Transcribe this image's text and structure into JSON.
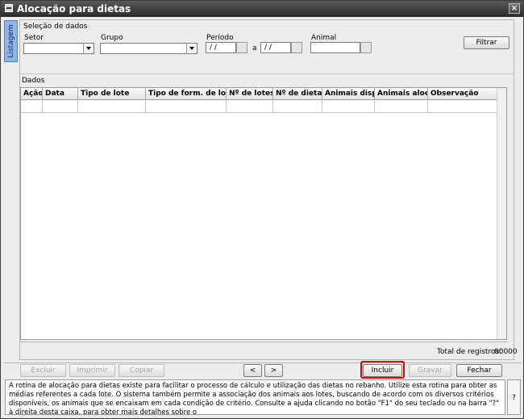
{
  "window": {
    "title": "Alocação para dietas",
    "close_glyph": "×"
  },
  "side_tab": {
    "label": "Listagem"
  },
  "selection": {
    "section_label": "Seleção de dados",
    "setor_label": "Setor",
    "grupo_label": "Grupo",
    "periodo_label": "Período",
    "periodo_start": "/ /",
    "periodo_sep": "a",
    "periodo_end": "/ /",
    "animal_label": "Animal",
    "filter_button": "Filtrar"
  },
  "data_section": {
    "label": "Dados",
    "columns": [
      "Ação",
      "Data",
      "Tipo de lote",
      "Tipo de form. de lote",
      "Nº de lotes",
      "Nº de dietas",
      "Animais disp.",
      "Animais aloc.",
      "Observação"
    ],
    "total_label": "Total de registros:",
    "total_value": "00000"
  },
  "toolbar": {
    "excluir": "Excluir",
    "imprimir": "Imprimir",
    "copiar": "Copiar",
    "prev": "<",
    "next": ">",
    "incluir": "Incluir",
    "gravar": "Gravar",
    "fechar": "Fechar"
  },
  "help": {
    "text": "A rotina de alocação para dietas existe para facilitar o processo de cálculo e utilização das dietas no rebanho. Utilize esta rotina para obter as médias referentes a cada lote. O sistema também permite a associação dos animais aos lotes, buscando de acordo com os diversos critérios disponíveis, os animais que se encaixam em cada condição de critério. Consulte a ajuda clicando no botão \"F1\" do seu teclado ou na barra \"?\" à direita desta caixa, para obter mais detalhes sobre o",
    "question": "?"
  },
  "colors": {
    "highlight": "#e00000",
    "side_tab": "#8fb4e8"
  }
}
